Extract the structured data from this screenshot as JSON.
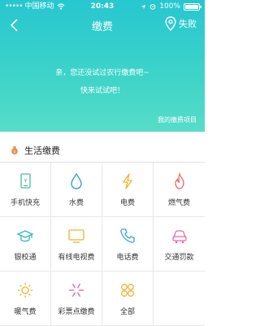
{
  "status_bar": {
    "signal": "•••••",
    "carrier": "中国移动",
    "time": "20:43",
    "battery_text": "100%"
  },
  "nav": {
    "title": "缴费",
    "location_label": "失败"
  },
  "promo": {
    "line1": "亲，您还没试过农行缴费吧~",
    "line2": "快来试试吧！",
    "my_records": "我的缴费项目"
  },
  "section": {
    "title": "生活缴费"
  },
  "services": [
    {
      "label": "手机快充",
      "icon": "phone-recharge-icon",
      "color": "#4fb9a7"
    },
    {
      "label": "水费",
      "icon": "water-drop-icon",
      "color": "#3b9fe0"
    },
    {
      "label": "电费",
      "icon": "lightning-icon",
      "color": "#f2b02e"
    },
    {
      "label": "燃气费",
      "icon": "flame-icon",
      "color": "#f06a6a"
    },
    {
      "label": "银校通",
      "icon": "graduation-cap-icon",
      "color": "#36b6c9"
    },
    {
      "label": "有线电视费",
      "icon": "tv-icon",
      "color": "#f2b02e"
    },
    {
      "label": "电话费",
      "icon": "telephone-icon",
      "color": "#3b9fe0"
    },
    {
      "label": "交通罚款",
      "icon": "car-icon",
      "color": "#e46aa8"
    },
    {
      "label": "暖气费",
      "icon": "sun-icon",
      "color": "#f2b02e"
    },
    {
      "label": "彩票点缴费",
      "icon": "lottery-burst-icon",
      "color": "#e46aa8"
    },
    {
      "label": "全部",
      "icon": "all-grid-icon",
      "color": "#f2b02e"
    }
  ]
}
